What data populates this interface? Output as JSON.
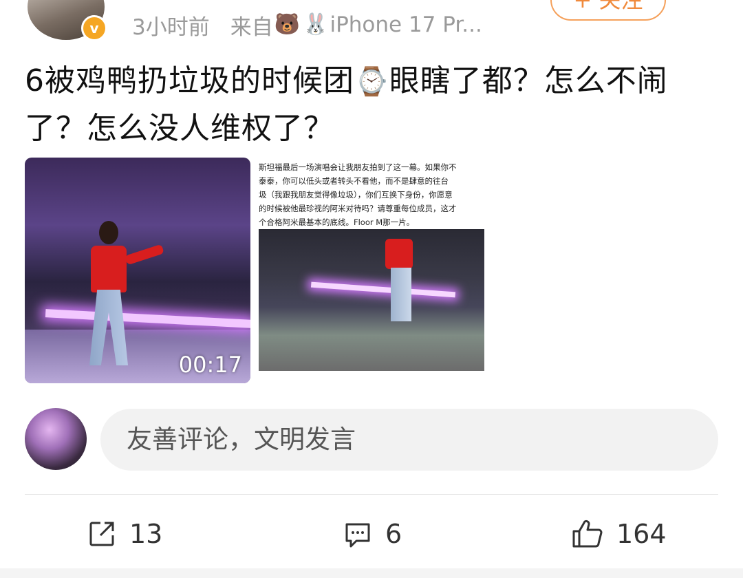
{
  "post": {
    "time": "3小时前",
    "source_prefix": "来自",
    "source_emojis": [
      "🐻",
      "🐰"
    ],
    "source_device": "iPhone 17 Pr...",
    "follow_label": "+ 关注",
    "verified_badge": "v",
    "text_part1": "6被鸡鸭扔垃圾的时候团",
    "text_emoji": "⌚",
    "text_part2": "眼瞎了都？怎么不闹了？怎么没人维权了？",
    "video_duration": "00:17",
    "image2_text_lines": [
      "斯坦福最后一场演唱会让我朋友拍到了这一幕。如果你不",
      "泰泰，你可以低头或者转头不看他，而不是肆意的往台",
      "圾（我跟我朋友觉得像垃圾），你们互换下身份，你愿意",
      "的时候被他最珍视的阿米对待吗？请尊重每位成员，这才",
      "个合格阿米最基本的底线。Floor M那一片。"
    ]
  },
  "comment_box": {
    "placeholder": "友善评论，文明发言"
  },
  "actions": {
    "share_count": "13",
    "comment_count": "6",
    "like_count": "164"
  },
  "colors": {
    "accent": "#f08a3c",
    "verified": "#f5a623",
    "meta_gray": "#9a9a9a"
  },
  "icons": [
    "share-icon",
    "comment-icon",
    "like-icon"
  ]
}
